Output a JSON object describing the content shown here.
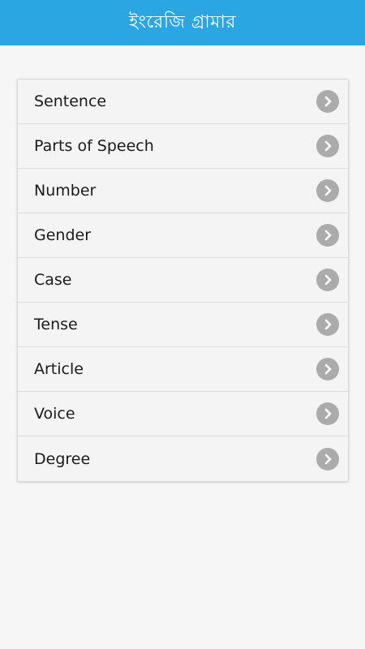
{
  "app_bar": {
    "title": "ইংরেজি গ্রামার",
    "color": "#2aa6e2"
  },
  "menu": {
    "items": [
      {
        "label": "Sentence",
        "icon": "chevron-right-icon"
      },
      {
        "label": "Parts of Speech",
        "icon": "chevron-right-icon"
      },
      {
        "label": "Number",
        "icon": "chevron-right-icon"
      },
      {
        "label": "Gender",
        "icon": "chevron-right-icon"
      },
      {
        "label": "Case",
        "icon": "chevron-right-icon"
      },
      {
        "label": "Tense",
        "icon": "chevron-right-icon"
      },
      {
        "label": "Article",
        "icon": "chevron-right-icon"
      },
      {
        "label": "Voice",
        "icon": "chevron-right-icon"
      },
      {
        "label": "Degree",
        "icon": "chevron-right-icon"
      }
    ]
  }
}
